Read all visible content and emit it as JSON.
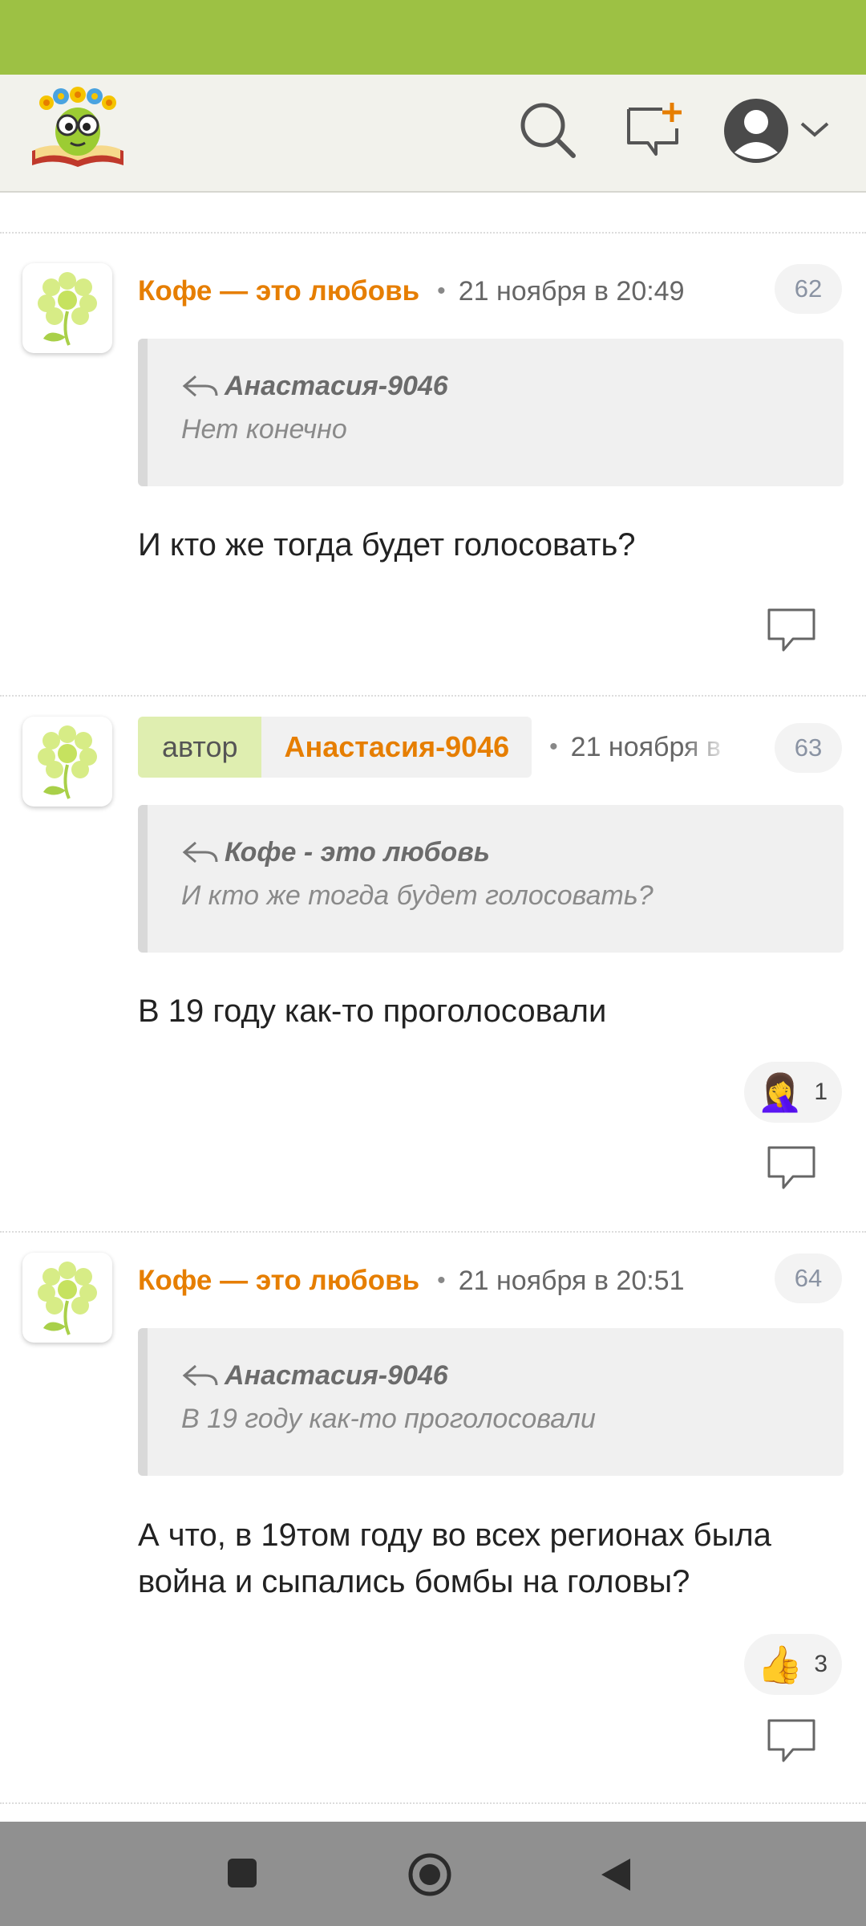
{
  "header": {
    "icons": [
      "logo-icon",
      "search-icon",
      "new-message-icon",
      "account-icon",
      "chevron-down-icon"
    ]
  },
  "comments": [
    {
      "author": "Кофе — это любовь",
      "date": "21 ноября в 20:49",
      "number": "62",
      "quote_author": "Анастасия-9046",
      "quote_text": "Нет конечно",
      "text": "И кто же тогда будет голосовать?"
    },
    {
      "author_label": "автор",
      "author": "Анастасия-9046",
      "date": "21 ноября в",
      "number": "63",
      "quote_author": "Кофе - это любовь",
      "quote_text": "И кто же тогда будет голосовать?",
      "text": "В 19 году как-то проголосовали",
      "reaction": {
        "emoji": "🤦‍♀️",
        "count": "1"
      }
    },
    {
      "author": "Кофе — это любовь",
      "date": "21 ноября в 20:51",
      "number": "64",
      "quote_author": "Анастасия-9046",
      "quote_text": "В 19 году как-то проголосовали",
      "text": "А что, в 19том году во всех регионах была война и сыпались бомбы на головы?",
      "reaction": {
        "emoji": "👍",
        "count": "3"
      }
    }
  ],
  "separator_dot": "•",
  "nav": {
    "icons": [
      "recent-apps-icon",
      "home-icon",
      "back-icon"
    ]
  },
  "colors": {
    "status_bar": "#9dc144",
    "author": "#e67e00",
    "header_bg": "#f2f2ec",
    "nav_bar": "#909090"
  }
}
